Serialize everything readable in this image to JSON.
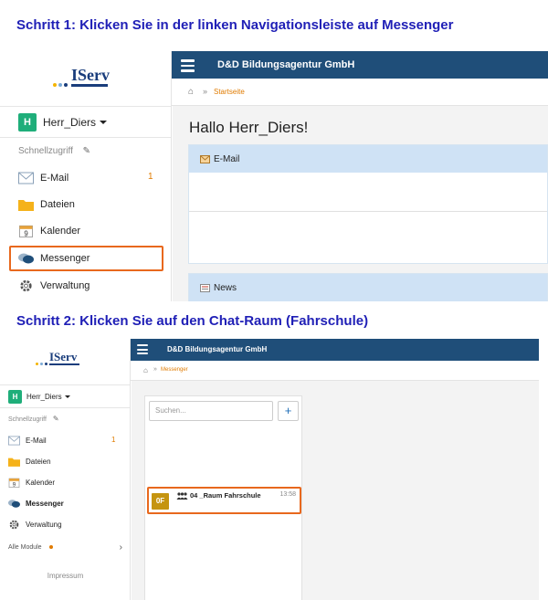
{
  "steps": [
    {
      "title": "Schritt 1: Klicken Sie in der linken Navigationsleiste auf Messenger"
    },
    {
      "title": "Schritt 2: Klicken Sie auf den Chat-Raum (Fahrschule)"
    }
  ],
  "colors": {
    "step_title": "#1f1fb6",
    "topbar": "#1f4e79",
    "accent_orange": "#e07b00",
    "highlight_frame": "#e8681d",
    "avatar_green": "#1fae7a",
    "room_avatar": "#c5940f",
    "panel_header": "#cfe2f5"
  },
  "app": {
    "logo_text": "IServ",
    "organization": "D&D Bildungsagentur GmbH",
    "user": {
      "initial": "H",
      "name": "Herr_Diers"
    },
    "quick_access_label": "Schnellzugriff",
    "nav": {
      "email": {
        "label": "E-Mail",
        "badge": "1",
        "icon": "envelope-icon"
      },
      "files": {
        "label": "Dateien",
        "icon": "folder-icon"
      },
      "calendar": {
        "label": "Kalender",
        "icon": "calendar-icon",
        "day": "9"
      },
      "messenger": {
        "label": "Messenger",
        "icon": "chat-bubbles-icon"
      },
      "admin": {
        "label": "Verwaltung",
        "icon": "gear-icon"
      }
    },
    "all_modules_label": "Alle Module",
    "impressum_label": "Impressum"
  },
  "screen1": {
    "breadcrumb": {
      "separator": "»",
      "current": "Startseite"
    },
    "greeting": "Hallo Herr_Diers!",
    "panels": {
      "email": "E-Mail",
      "news": "News"
    }
  },
  "screen2": {
    "breadcrumb": {
      "separator": "»",
      "current": "Messenger"
    },
    "search_placeholder": "Suchen...",
    "add_label": "+",
    "room": {
      "initials": "0F",
      "name": "04 _Raum Fahrschule",
      "time": "13:58"
    }
  }
}
